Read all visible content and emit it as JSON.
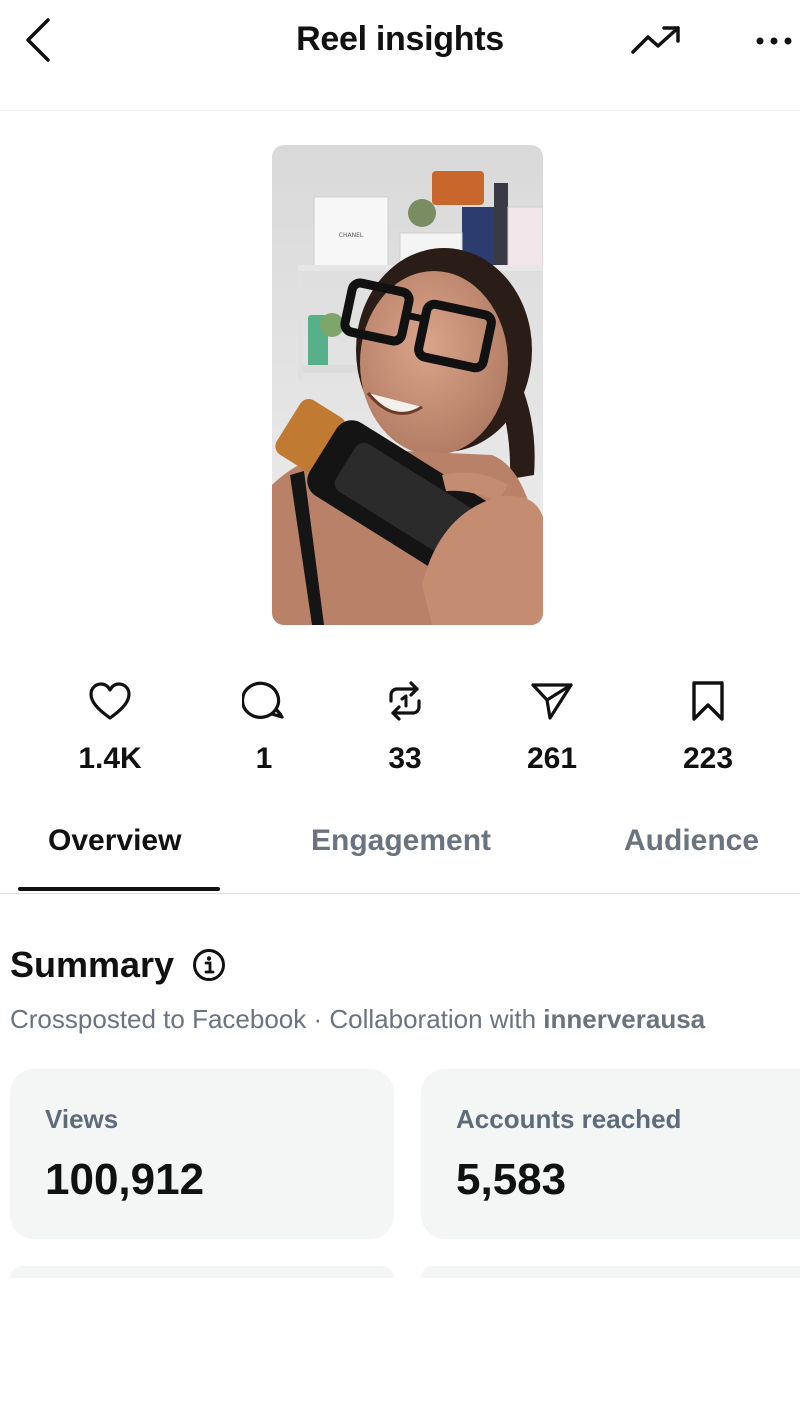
{
  "header": {
    "title": "Reel insights",
    "back_icon": "chevron-left-icon",
    "trend_icon": "trending-up-icon",
    "more_icon": "more-horizontal-icon"
  },
  "stats": {
    "likes": "1.4K",
    "comments": "1",
    "reposts": "33",
    "shares": "261",
    "saves": "223"
  },
  "tabs": {
    "overview": "Overview",
    "engagement": "Engagement",
    "audience": "Audience",
    "active": "Overview"
  },
  "summary": {
    "heading": "Summary",
    "crosspost": "Crossposted to Facebook · Collaboration with ",
    "collaborator": "innerverausa",
    "views_label": "Views",
    "views_value": "100,912",
    "reached_label": "Accounts reached",
    "reached_value": "5,583"
  },
  "thumbnail": {
    "box_text": "CHANEL"
  },
  "colors": {
    "text": "#111111",
    "muted": "#6b7280",
    "card_bg": "#f4f6f6",
    "divider": "#dddddd"
  }
}
